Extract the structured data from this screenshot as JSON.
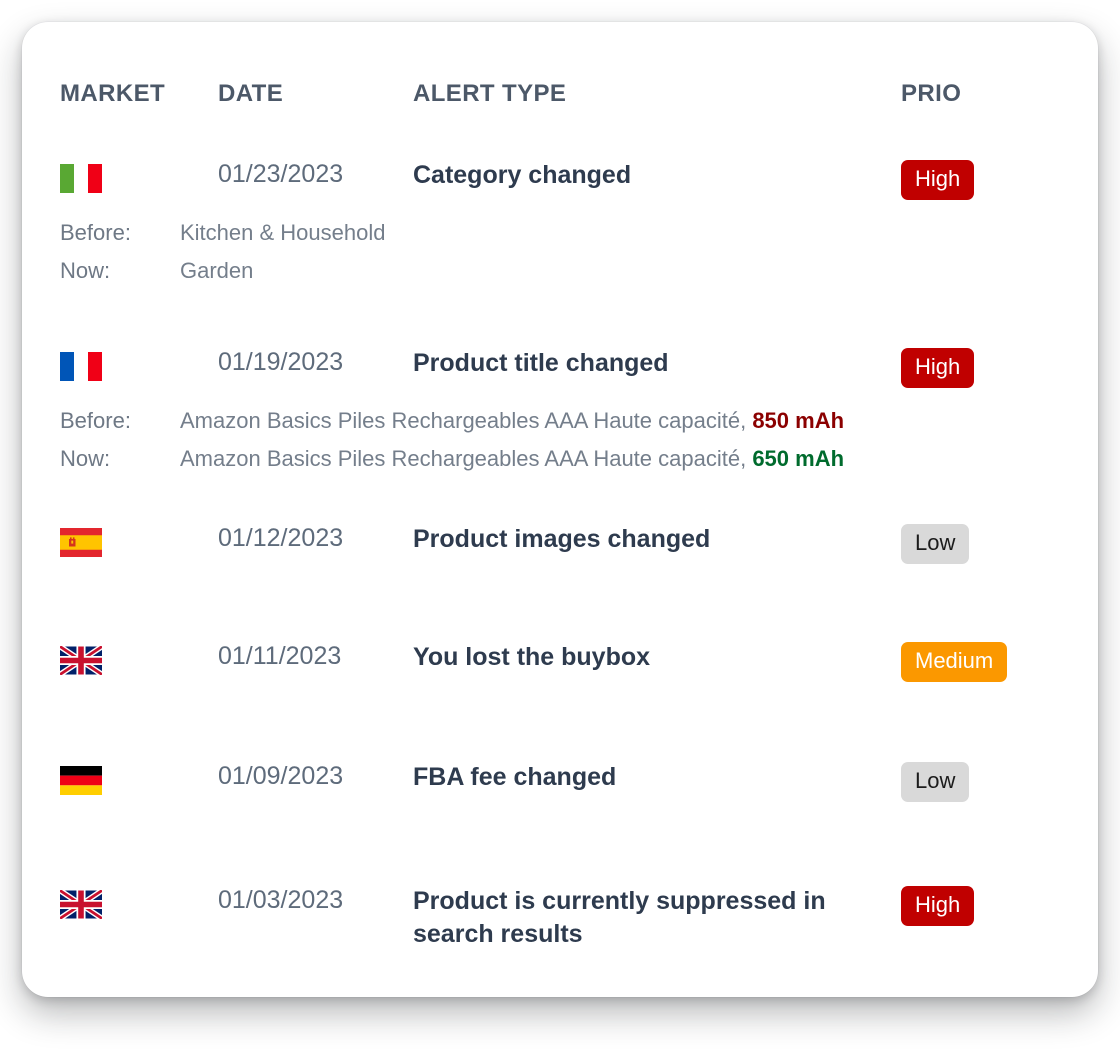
{
  "table": {
    "columns": {
      "market": "MARKET",
      "date": "DATE",
      "alert_type": "ALERT TYPE",
      "prio": "PRIO"
    },
    "labels": {
      "before": "Before:",
      "now": "Now:"
    },
    "colors": {
      "high": "#c00000",
      "medium": "#fb9800",
      "low": "#d9d9d9",
      "alert_text": "#2e3b4e",
      "date_text": "#5e6b7b",
      "header_text": "#4c5868",
      "detail_text": "#747e8b",
      "highlight_before": "#8b0000",
      "highlight_now": "#006b2d"
    },
    "rows": [
      {
        "market_flag": "flag-italy",
        "market_name": "Italy",
        "date": "01/23/2023",
        "alert_type": "Category changed",
        "priority": "High",
        "priority_level": "high",
        "detail_before": "Kitchen & Household",
        "detail_now": "Garden",
        "detail_before_prefix": "",
        "detail_before_highlight": "",
        "detail_now_prefix": "",
        "detail_now_highlight": ""
      },
      {
        "market_flag": "flag-france",
        "market_name": "France",
        "date": "01/19/2023",
        "alert_type": "Product title changed",
        "priority": "High",
        "priority_level": "high",
        "detail_before": "Amazon Basics Piles Rechargeables AAA Haute capacité, 850 mAh",
        "detail_now": "Amazon Basics Piles Rechargeables AAA Haute capacité, 650 mAh",
        "detail_before_prefix": "Amazon Basics Piles Rechargeables AAA Haute capacité, ",
        "detail_before_highlight": "850 mAh",
        "detail_now_prefix": "Amazon Basics Piles Rechargeables AAA Haute capacité, ",
        "detail_now_highlight": "650 mAh"
      },
      {
        "market_flag": "flag-spain",
        "market_name": "Spain",
        "date": "01/12/2023",
        "alert_type": "Product images changed",
        "priority": "Low",
        "priority_level": "low"
      },
      {
        "market_flag": "flag-uk",
        "market_name": "United Kingdom",
        "date": "01/11/2023",
        "alert_type": "You lost the buybox",
        "priority": "Medium",
        "priority_level": "medium"
      },
      {
        "market_flag": "flag-germany",
        "market_name": "Germany",
        "date": "01/09/2023",
        "alert_type": "FBA fee changed",
        "priority": "Low",
        "priority_level": "low"
      },
      {
        "market_flag": "flag-uk",
        "market_name": "United Kingdom",
        "date": "01/03/2023",
        "alert_type": "Product is currently suppressed in search results",
        "priority": "High",
        "priority_level": "high"
      }
    ]
  }
}
